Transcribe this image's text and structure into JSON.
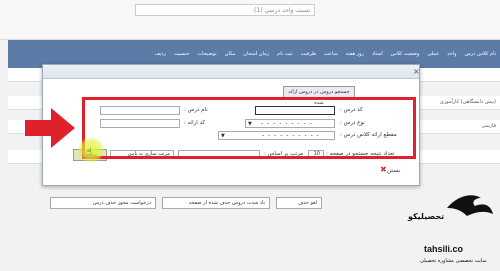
{
  "topbar": {
    "search_text": "نسبت واحد درسی (1)"
  },
  "grid": {
    "headers": [
      "نام کلاس درس",
      "واحد",
      "عملی",
      "وضعیت کلاس",
      "استاد",
      "روز هفته",
      "ساعت",
      "ظرفیت",
      "ثبت نام",
      "زمان امتحان",
      "مکان",
      "توضیحات",
      "جنسیت",
      "ردیف"
    ],
    "side_rows": [
      "(بیش دانشگاهی) کارآموزی",
      "فارسی"
    ]
  },
  "modal": {
    "search_tab": "جستجو دروس در دروس ارائه شده",
    "close_label": "×",
    "fields": {
      "course_code_label": "کد درس :",
      "course_name_label": "نام درس :",
      "course_type_label": "نوع درس :",
      "offer_code_label": "کد ارائه :",
      "class_section_label": "مقطع ارائه کلاس درس :",
      "course_type_value": "- - - - - - - - -",
      "class_section_value": "- - - - - - - - - -"
    },
    "controls": {
      "search_button": "جستجو",
      "sort_label": "مرتب سازی به پایین",
      "sort_by_label": "مرتب بر اساس :",
      "per_page_label": "تعداد نتیجه جستجو در صفحه :",
      "per_page_value": "10"
    },
    "close_button": "بستن"
  },
  "bottom": {
    "btn_cancel": "لغو حذف",
    "btn_selected": "یاد شدت دروس حذف شده از صفحه",
    "btn_next": "درخواست مجوز حذف درس"
  },
  "watermark": {
    "brand": "تحصیلیکو",
    "domain": "tahsili.co",
    "tagline": "سایت تخصصی مشاوره تحصیلی"
  },
  "colors": {
    "accent_red": "#e0202a",
    "grid_header": "#5c7ba6",
    "cursor_highlight": "#e1f53c"
  }
}
